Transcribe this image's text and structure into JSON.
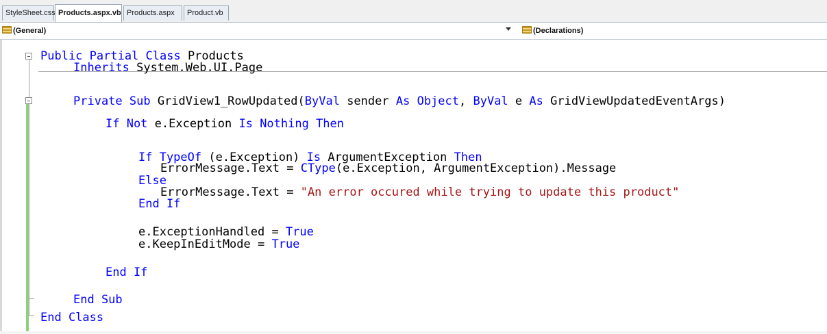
{
  "tabs": [
    {
      "label": "StyleSheet.css",
      "active": false
    },
    {
      "label": "Products.aspx.vb",
      "active": true
    },
    {
      "label": "Products.aspx",
      "active": false
    },
    {
      "label": "Product.vb",
      "active": false
    }
  ],
  "navbar": {
    "class_dropdown": "(General)",
    "member_dropdown": "(Declarations)"
  },
  "code": {
    "l1": {
      "kw1": "Public Partial Class",
      "t1": " Products"
    },
    "l2": {
      "kw1": "Inherits",
      "t1": " System.Web.UI.Page"
    },
    "l3": {
      "kw1": "Private Sub",
      "t1": " GridView1_RowUpdated(",
      "kw2": "ByVal",
      "t2": " sender ",
      "kw3": "As",
      "t3": " ",
      "kw4": "Object",
      "t4": ", ",
      "kw5": "ByVal",
      "t5": " e ",
      "kw6": "As",
      "t6": " GridViewUpdatedEventArgs)"
    },
    "l4": {
      "kw1": "If Not",
      "t1": " e.Exception ",
      "kw2": "Is Nothing Then"
    },
    "l5": {
      "kw1": "If TypeOf",
      "t1": " (e.Exception) ",
      "kw2": "Is",
      "t2": " ArgumentException ",
      "kw3": "Then"
    },
    "l6": {
      "t1": "ErrorMessage.Text = ",
      "kw1": "CType",
      "t2": "(e.Exception, ArgumentException).Message"
    },
    "l7": {
      "kw1": "Else"
    },
    "l8": {
      "t1": "ErrorMessage.Text = ",
      "s1": "\"An error occured while trying to update this product\""
    },
    "l9": {
      "kw1": "End If"
    },
    "l10": {
      "t1": "e.ExceptionHandled = ",
      "kw1": "True"
    },
    "l11": {
      "t1": "e.KeepInEditMode = ",
      "kw1": "True"
    },
    "l12": {
      "kw1": "End If"
    },
    "l13": {
      "kw1": "End Sub"
    },
    "l14": {
      "kw1": "End Class"
    }
  },
  "colors": {
    "keyword": "#0000ff",
    "string": "#a31515",
    "text": "#000000",
    "change_bar": "#8fd07f"
  },
  "icons": [
    "class-icon",
    "declarations-icon",
    "dropdown-arrow-icon",
    "collapse-icon"
  ]
}
